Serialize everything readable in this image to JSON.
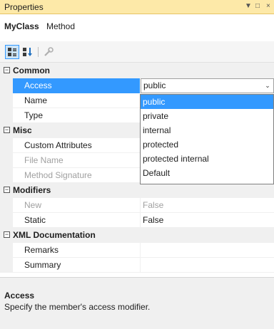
{
  "window": {
    "title": "Properties",
    "controls": {
      "menu": "▼",
      "float": "□",
      "close": "×"
    }
  },
  "object": {
    "name": "MyClass",
    "type": "Method"
  },
  "toolbar": {
    "icons": [
      "categorized-icon",
      "alphabetical-icon",
      "property-pages-icon"
    ]
  },
  "grid": {
    "categories": {
      "common": {
        "toggle": "⊟",
        "label": "Common"
      },
      "misc": {
        "toggle": "⊟",
        "label": "Misc"
      },
      "modifiers": {
        "toggle": "⊟",
        "label": "Modifiers"
      },
      "xml": {
        "toggle": "⊟",
        "label": "XML Documentation"
      }
    },
    "props": {
      "access": {
        "name": "Access",
        "value": "public"
      },
      "name": {
        "name": "Name",
        "value": ""
      },
      "type": {
        "name": "Type",
        "value": ""
      },
      "custom_attributes": {
        "name": "Custom Attributes",
        "value": ""
      },
      "file_name": {
        "name": "File Name",
        "value": ""
      },
      "method_signature": {
        "name": "Method Signature",
        "value": ""
      },
      "new": {
        "name": "New",
        "value": "False"
      },
      "static": {
        "name": "Static",
        "value": "False"
      },
      "remarks": {
        "name": "Remarks",
        "value": ""
      },
      "summary": {
        "name": "Summary",
        "value": ""
      }
    },
    "dropdown_arrow": "⌄"
  },
  "dropdown": {
    "options": [
      "public",
      "private",
      "internal",
      "protected",
      "protected internal",
      "Default"
    ],
    "selected": "public"
  },
  "description": {
    "title": "Access",
    "text": "Specify the member's access modifier."
  },
  "colors": {
    "titlebar": "#fde9a8",
    "selection": "#3399ff"
  }
}
